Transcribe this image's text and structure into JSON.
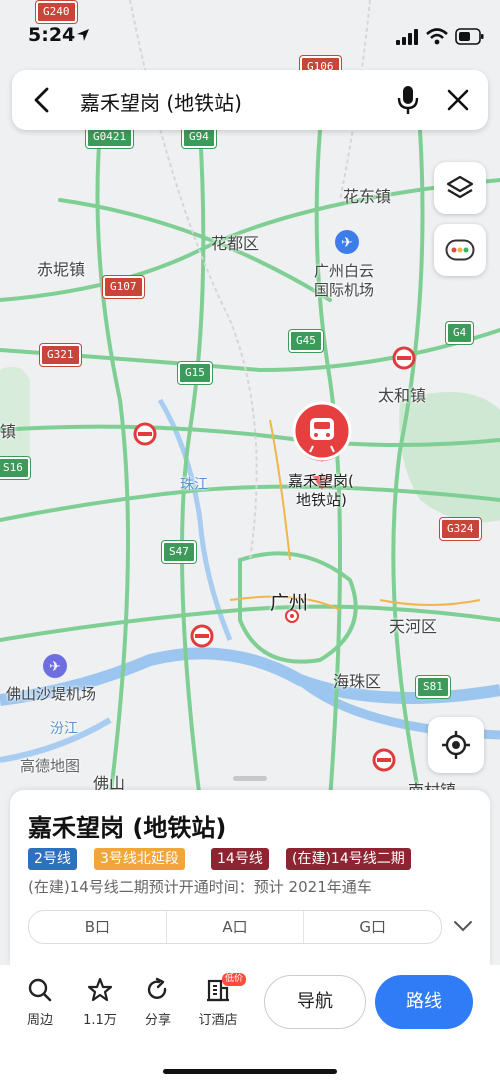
{
  "status": {
    "time": "5:24"
  },
  "search": {
    "query": "嘉禾望岗 (地铁站)"
  },
  "map": {
    "road_shields": [
      {
        "label": "G240",
        "style": "red"
      },
      {
        "label": "G106",
        "style": "red"
      },
      {
        "label": "G0421",
        "style": "green"
      },
      {
        "label": "G94",
        "style": "green"
      },
      {
        "label": "G107",
        "style": "red"
      },
      {
        "label": "G45",
        "style": "green"
      },
      {
        "label": "G4",
        "style": "green"
      },
      {
        "label": "G321",
        "style": "red"
      },
      {
        "label": "G15",
        "style": "green"
      },
      {
        "label": "S16",
        "style": "green"
      },
      {
        "label": "S47",
        "style": "green"
      },
      {
        "label": "G324",
        "style": "red"
      },
      {
        "label": "S81",
        "style": "green"
      }
    ],
    "places": {
      "huadong": "花东镇",
      "huadu": "花都区",
      "chini": "赤坭镇",
      "airport_line1": "广州白云",
      "airport_line2": "国际机场",
      "taihe": "太和镇",
      "zhen": "镇",
      "zhujiang": "珠江",
      "station_line1": "嘉禾望岗(",
      "station_line2": "地铁站)",
      "guangzhou": "广州",
      "tianhe": "天河区",
      "haizhu": "海珠区",
      "foshan_airport": "佛山沙堤机场",
      "fenjiang": "汾江",
      "gaode": "高德地图",
      "foshan": "佛山",
      "nancun": "南村镇"
    }
  },
  "sheet": {
    "title": "嘉禾望岗 (地铁站)",
    "tags": [
      {
        "label": "2号线",
        "bg": "#2f6fbf",
        "fg": "#ffffff"
      },
      {
        "label": "3号线北延段",
        "bg": "#f0a63a",
        "fg": "#ffffff"
      },
      {
        "label": "14号线",
        "bg": "#8e2431",
        "fg": "#ffffff"
      },
      {
        "label": "(在建)14号线二期",
        "bg": "#8e2431",
        "fg": "#ffffff"
      }
    ],
    "note": "(在建)14号线二期预计开通时间：预计 2021年通车",
    "exits": [
      "B口",
      "A口",
      "G口"
    ]
  },
  "toolbar": {
    "nearby": "周边",
    "favorites": "1.1万",
    "share": "分享",
    "hotel": "订酒店",
    "hotel_badge": "低价",
    "navigate": "导航",
    "route": "路线"
  },
  "colors": {
    "accent": "#2f7cf6",
    "marker": "#e53f3f"
  }
}
